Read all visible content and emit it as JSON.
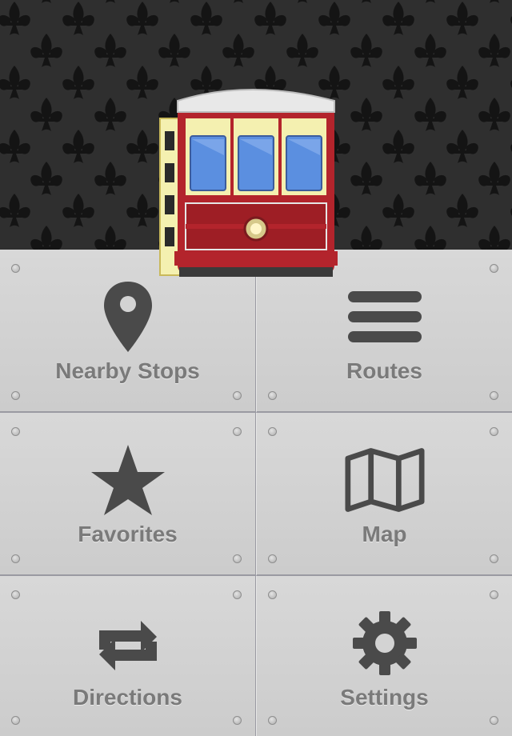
{
  "app": {
    "header_image": "streetcar-logo",
    "background_pattern": "fleur-de-lis",
    "colors": {
      "header_bg": "#2f2f2f",
      "pattern": "#141414",
      "tile_bg": "#d3d3d3",
      "label": "#7a7a7a",
      "icon": "#4a4a4a",
      "streetcar_red": "#b3242c",
      "streetcar_cream": "#f4f0b0",
      "window_blue": "#5b8fe0"
    }
  },
  "menu": {
    "items": [
      {
        "label": "Nearby Stops",
        "icon": "map-pin-icon"
      },
      {
        "label": "Routes",
        "icon": "list-lines-icon"
      },
      {
        "label": "Favorites",
        "icon": "star-icon"
      },
      {
        "label": "Map",
        "icon": "folded-map-icon"
      },
      {
        "label": "Directions",
        "icon": "repeat-arrows-icon"
      },
      {
        "label": "Settings",
        "icon": "gear-icon"
      }
    ]
  }
}
